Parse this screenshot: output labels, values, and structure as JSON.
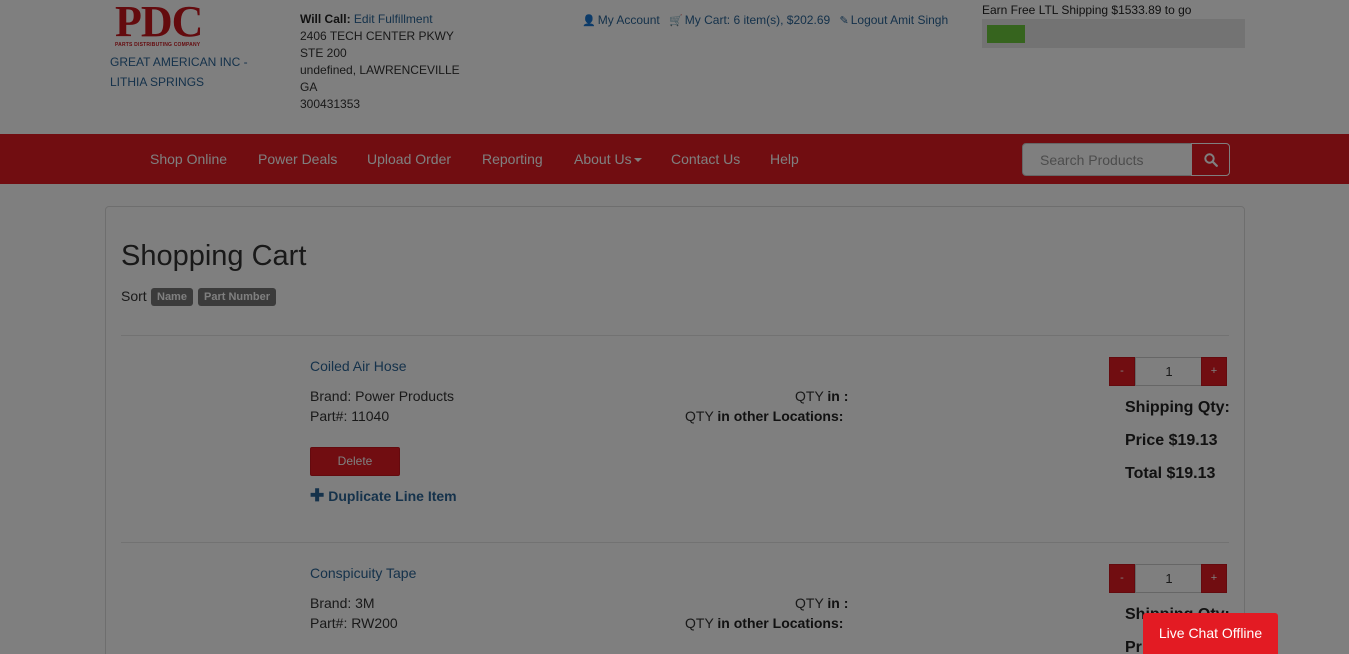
{
  "header": {
    "logo_text": "PDC",
    "logo_subtext": "PARTS DISTRIBUTING COMPANY",
    "store_name": "GREAT AMERICAN INC - LITHIA SPRINGS",
    "will_call_label": "Will Call:",
    "edit_fulfillment": "Edit Fulfillment",
    "address_line1": "2406 TECH CENTER PKWY",
    "address_line2": "STE 200",
    "address_line3": "undefined, LAWRENCEVILLE",
    "address_line4": "GA",
    "address_line5": "300431353",
    "my_account": "My Account",
    "my_cart": "My Cart: 6 item(s), $202.69",
    "logout": "Logout Amit Singh",
    "ltl_text": "Earn Free LTL Shipping $1533.89 to go",
    "ltl_progress_fraction": 0.15
  },
  "nav": {
    "items": [
      "Shop Online",
      "Power Deals",
      "Upload Order",
      "Reporting",
      "About Us",
      "Contact Us",
      "Help"
    ],
    "search_placeholder": "Search Products"
  },
  "cart": {
    "title": "Shopping Cart",
    "sort_label": "Sort",
    "sort_options": [
      "Name",
      "Part Number"
    ],
    "items": [
      {
        "name": "Coiled Air Hose",
        "brand": "Brand: Power Products",
        "part": "Part#: 11040",
        "qty_in_prefix": "QTY",
        "qty_in_suffix": "in :",
        "qty_other_prefix": "QTY",
        "qty_other_suffix": "in other Locations:",
        "delete_label": "Delete",
        "duplicate_label": "Duplicate Line Item",
        "quantity": "1",
        "minus": "-",
        "plus": "+",
        "shipping_qty": "Shipping Qty:",
        "price": "Price $19.13",
        "total": "Total $19.13"
      },
      {
        "name": "Conspicuity Tape",
        "brand": "Brand: 3M",
        "part": "Part#: RW200",
        "qty_in_prefix": "QTY",
        "qty_in_suffix": "in :",
        "qty_other_prefix": "QTY",
        "qty_other_suffix": "in other Locations:",
        "quantity": "1",
        "minus": "-",
        "plus": "+",
        "shipping_qty": "Shipping Qty:",
        "price": "Price"
      }
    ]
  },
  "live_chat": "Live Chat Offline",
  "colors": {
    "brand_red": "#e31b23",
    "link_blue": "#2a6496",
    "progress_green": "#6cc83c",
    "overlay": "rgba(0,0,0,0.5)"
  }
}
